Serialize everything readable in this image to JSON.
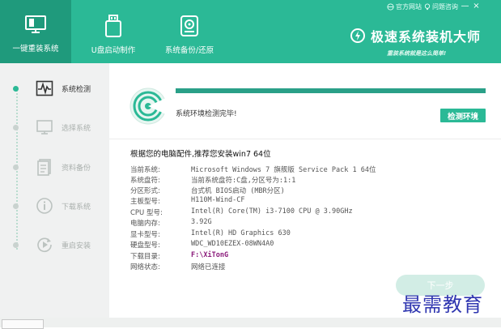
{
  "colors": {
    "brand_green": "#2bb996",
    "brand_green_dark": "#1f9a7c",
    "sidebar_bg": "#f0f1f1",
    "path_purple": "#8a1a7a",
    "watermark_blue": "#2f36b0"
  },
  "header": {
    "nav": [
      {
        "label": "一键重装系统",
        "icon": "monitor-icon",
        "active": true
      },
      {
        "label": "U盘启动制作",
        "icon": "usb-drive-icon",
        "active": false
      },
      {
        "label": "系统备份/还原",
        "icon": "disk-backup-icon",
        "active": false
      }
    ],
    "links": {
      "website": "官方网站",
      "help": "问题咨询"
    },
    "window_controls": {
      "minimize": "—",
      "close": "×"
    },
    "brand": {
      "title": "极速系统装机大师",
      "slogan": "重装系统就是这么简单!",
      "icon": "power-icon"
    }
  },
  "sidebar": {
    "steps": [
      {
        "label": "系统检测",
        "icon": "pulse-monitor-icon",
        "active": true
      },
      {
        "label": "选择系统",
        "icon": "monitor-icon",
        "active": false
      },
      {
        "label": "资料备份",
        "icon": "document-icon",
        "active": false
      },
      {
        "label": "下载系统",
        "icon": "info-icon",
        "active": false
      },
      {
        "label": "重启安装",
        "icon": "restart-icon",
        "active": false
      }
    ]
  },
  "main": {
    "progress": 1.0,
    "status_text": "系统环境检测完毕!",
    "check_button": "检测环境",
    "recommend": "根据您的电脑配件,推荐您安装win7 64位",
    "info": [
      {
        "key": "当前系统:",
        "value": "Microsoft Windows 7 旗舰版 Service Pack 1 64位"
      },
      {
        "key": "系统盘符:",
        "value": "当前系统盘符:C盘,分区号为:1:1"
      },
      {
        "key": "分区形式:",
        "value": "台式机 BIOS启动 (MBR分区)"
      },
      {
        "key": "主板型号:",
        "value": "H110M-Wind-CF"
      },
      {
        "key": "CPU 型号:",
        "value": "Intel(R) Core(TM) i3-7100 CPU @ 3.90GHz"
      },
      {
        "key": "电脑内存:",
        "value": "3.92G"
      },
      {
        "key": "显卡型号:",
        "value": "Intel(R) HD Graphics 630"
      },
      {
        "key": "硬盘型号:",
        "value": "WDC_WD10EZEX-08WN4A0"
      },
      {
        "key": "下载目录:",
        "value": "F:\\XiTonG"
      },
      {
        "key": "网络状态:",
        "value": "网络已连接"
      }
    ],
    "next_button": "下一步"
  },
  "watermark": "最需教育"
}
